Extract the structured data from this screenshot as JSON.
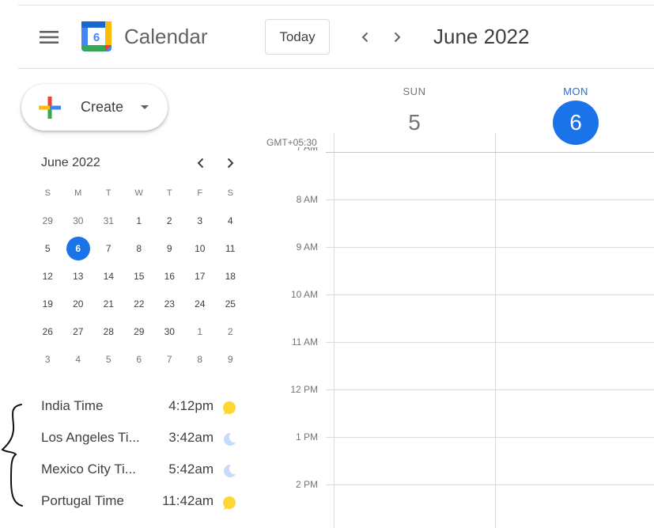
{
  "header": {
    "app_title": "Calendar",
    "logo_day": "6",
    "today_label": "Today",
    "period_title": "June 2022",
    "icons": {
      "menu": "hamburger-menu-icon",
      "prev": "chevron-left-icon",
      "next": "chevron-right-icon"
    }
  },
  "create": {
    "label": "Create"
  },
  "mini_calendar": {
    "title": "June 2022",
    "weekday_labels": [
      "S",
      "M",
      "T",
      "W",
      "T",
      "F",
      "S"
    ],
    "weeks": [
      [
        "29",
        "30",
        "31",
        "1",
        "2",
        "3",
        "4"
      ],
      [
        "5",
        "6",
        "7",
        "8",
        "9",
        "10",
        "11"
      ],
      [
        "12",
        "13",
        "14",
        "15",
        "16",
        "17",
        "18"
      ],
      [
        "19",
        "20",
        "21",
        "22",
        "23",
        "24",
        "25"
      ],
      [
        "26",
        "27",
        "28",
        "29",
        "30",
        "1",
        "2"
      ],
      [
        "3",
        "4",
        "5",
        "6",
        "7",
        "8",
        "9"
      ]
    ],
    "selected": "6"
  },
  "world_clock": [
    {
      "name": "India Time",
      "time": "4:12pm",
      "icon": "sun-icon"
    },
    {
      "name": "Los Angeles Ti...",
      "time": "3:42am",
      "icon": "moon-icon"
    },
    {
      "name": "Mexico City Ti...",
      "time": "5:42am",
      "icon": "moon-icon"
    },
    {
      "name": "Portugal Time",
      "time": "11:42am",
      "icon": "sun-icon"
    }
  ],
  "grid": {
    "timezone": "GMT+05:30",
    "days": [
      {
        "name": "SUN",
        "number": "5"
      },
      {
        "name": "MON",
        "number": "6"
      }
    ],
    "hours": [
      "7 AM",
      "8 AM",
      "9 AM",
      "10 AM",
      "11 AM",
      "12 PM",
      "1 PM",
      "2 PM"
    ]
  },
  "colors": {
    "accent": "#1a73e8",
    "text": "#3c4043",
    "muted": "#70757a",
    "gridline": "#dadce0",
    "sun": "#fdd835",
    "moon": "#c6dafc"
  }
}
